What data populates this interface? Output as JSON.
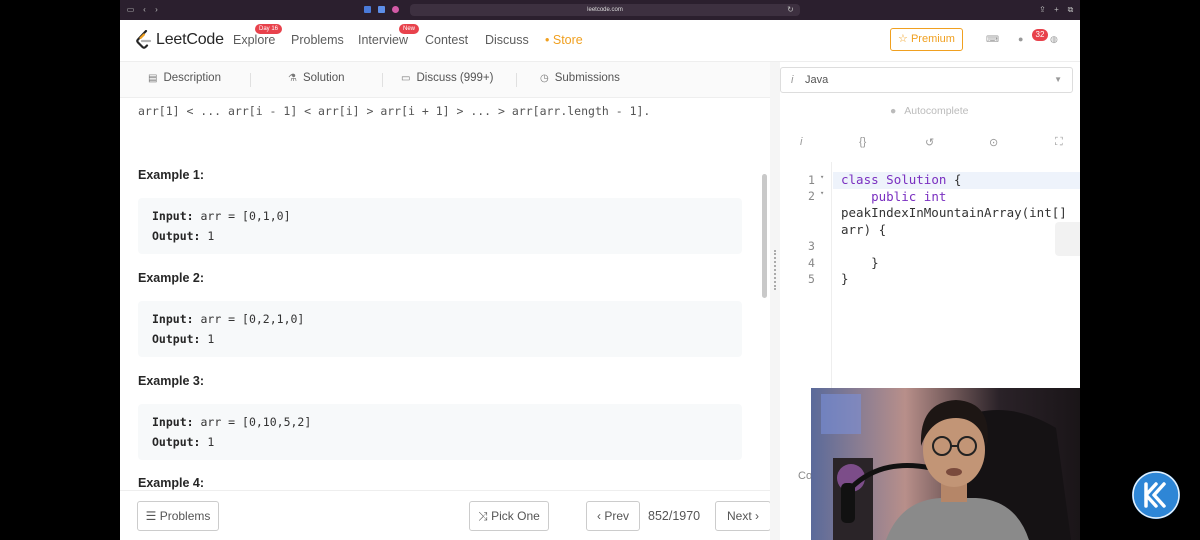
{
  "browser": {
    "url": "leetcode.com"
  },
  "nav": {
    "logo_text": "LeetCode",
    "links": [
      {
        "label": "Explore",
        "badge": "Day 16"
      },
      {
        "label": "Problems"
      },
      {
        "label": "Interview",
        "badge": "New"
      },
      {
        "label": "Contest"
      },
      {
        "label": "Discuss"
      },
      {
        "label": "Store",
        "prefix": "•"
      }
    ],
    "premium_label": "☆ Premium",
    "notification_count": "32",
    "accent_color": "#f0a020",
    "badge_color": "#e8424c"
  },
  "tabs": [
    {
      "label": "Description",
      "icon": "document-icon"
    },
    {
      "label": "Solution",
      "icon": "flask-icon"
    },
    {
      "label": "Discuss (999+)",
      "icon": "chat-icon"
    },
    {
      "label": "Submissions",
      "icon": "clock-icon"
    }
  ],
  "description": {
    "constraint_text": "arr[1] < ... arr[i - 1] < arr[i] > arr[i + 1] > ... > arr[arr.length - 1].",
    "examples": [
      {
        "title": "Example 1:",
        "input_label": "Input:",
        "input": "arr = [0,1,0]",
        "output_label": "Output:",
        "output": "1"
      },
      {
        "title": "Example 2:",
        "input_label": "Input:",
        "input": "arr = [0,2,1,0]",
        "output_label": "Output:",
        "output": "1"
      },
      {
        "title": "Example 3:",
        "input_label": "Input:",
        "input": "arr = [0,10,5,2]",
        "output_label": "Output:",
        "output": "1"
      },
      {
        "title": "Example 4:"
      }
    ]
  },
  "bottom": {
    "problems_label": "Problems",
    "pick_one_label": "Pick One",
    "prev_label": "Prev",
    "page_count": "852/1970",
    "next_label": "Next"
  },
  "editor": {
    "language": "Java",
    "autocomplete_label": "Autocomplete",
    "line_numbers": [
      "1",
      "2",
      "3",
      "4",
      "5"
    ],
    "console_peek": "Co"
  },
  "watermark": {
    "text": "KK",
    "color": "#2e86d6"
  }
}
